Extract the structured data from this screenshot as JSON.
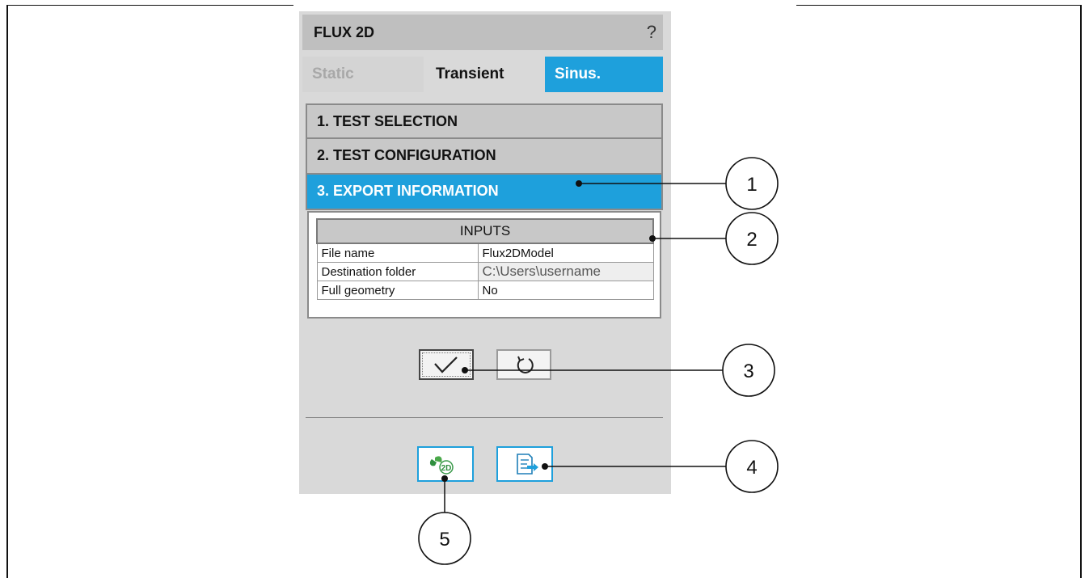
{
  "panel": {
    "title": "FLUX 2D",
    "help_label": "?",
    "tabs": [
      {
        "label": "Static",
        "state": "disabled"
      },
      {
        "label": "Transient",
        "state": "normal"
      },
      {
        "label": "Sinus.",
        "state": "selected"
      }
    ],
    "sections": [
      {
        "label": "1. TEST SELECTION",
        "active": false
      },
      {
        "label": "2. TEST CONFIGURATION",
        "active": false
      },
      {
        "label": "3. EXPORT INFORMATION",
        "active": true
      }
    ],
    "inputs": {
      "header": "INPUTS",
      "rows": [
        {
          "label": "File name",
          "value": "Flux2DModel"
        },
        {
          "label": "Destination folder",
          "value": "C:\\Users\\username"
        },
        {
          "label": "Full geometry",
          "value": "No"
        }
      ]
    },
    "buttons": {
      "apply_icon": "checkmark-icon",
      "reset_icon": "reset-icon",
      "flux2d_icon": "flux-2d-icon",
      "export_icon": "export-icon",
      "flux2d_badge": "2D"
    }
  },
  "callouts": [
    "1",
    "2",
    "3",
    "4",
    "5"
  ],
  "colors": {
    "accent": "#1ea0dc",
    "panel_bg": "#d9d9d9",
    "section_bg": "#c8c8c8"
  }
}
